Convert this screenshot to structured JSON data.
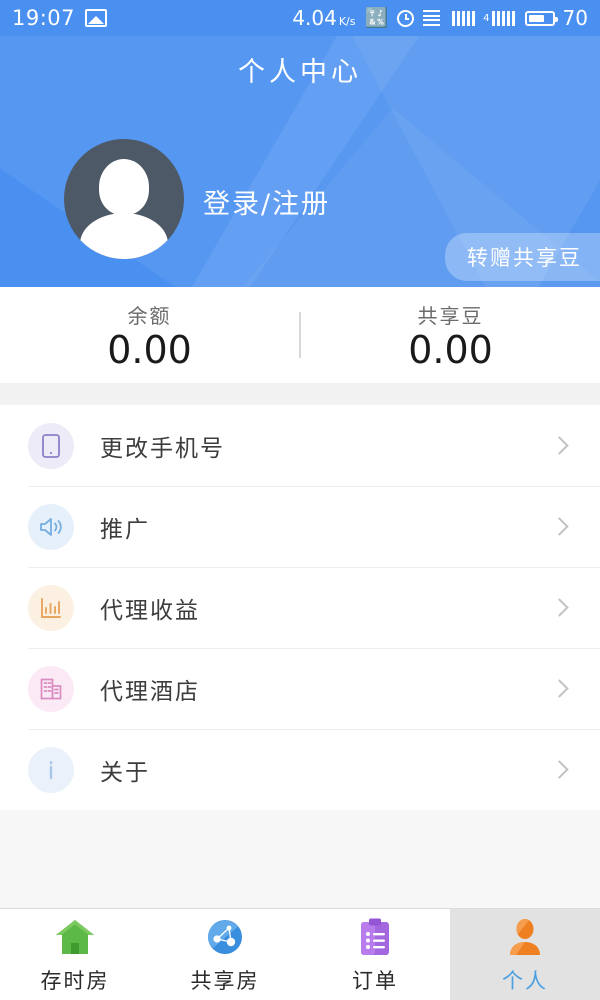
{
  "status_bar": {
    "time": "19:07",
    "screenshot_icon": "image-icon",
    "network_speed": "4.04",
    "network_speed_unit": "K/s",
    "bluetooth_icon": "bluetooth-icon",
    "alarm_icon": "alarm-clock-icon",
    "menu_icon": "list-lines-icon",
    "signal_icon": "signal-bars-icon",
    "network_type": "4",
    "battery_icon": "battery-icon",
    "battery_percent": "70"
  },
  "header": {
    "title": "个人中心",
    "avatar_icon": "user-avatar-placeholder",
    "login_label": "登录/注册",
    "transfer_button": "转赠共享豆",
    "bg_color": "#4a90f0"
  },
  "balance": {
    "items": [
      {
        "label": "余额",
        "value": "0.00"
      },
      {
        "label": "共享豆",
        "value": "0.00"
      }
    ]
  },
  "menu": {
    "items": [
      {
        "label": "更改手机号",
        "icon": "phone-icon",
        "icon_color": "#8b80c8",
        "icon_bg": "#eeebf8"
      },
      {
        "label": "推广",
        "icon": "speaker-icon",
        "icon_color": "#76aee0",
        "icon_bg": "#e6f0fa"
      },
      {
        "label": "代理收益",
        "icon": "bar-chart-icon",
        "icon_color": "#e8a55e",
        "icon_bg": "#fbf0e2"
      },
      {
        "label": "代理酒店",
        "icon": "building-icon",
        "icon_color": "#d98ac0",
        "icon_bg": "#fbeaf5"
      },
      {
        "label": "关于",
        "icon": "info-icon",
        "icon_color": "#a8c7ea",
        "icon_bg": "#eaf1fa"
      }
    ]
  },
  "tabbar": {
    "tabs": [
      {
        "label": "存时房",
        "icon": "home-icon",
        "icon_color": "#5cb947",
        "active": false
      },
      {
        "label": "共享房",
        "icon": "globe-icon",
        "icon_color": "#3a8ede",
        "active": false
      },
      {
        "label": "订单",
        "icon": "clipboard-icon",
        "icon_color": "#a濃",
        "active": false
      },
      {
        "label": "个人",
        "icon": "person-icon",
        "icon_color": "#ee8022",
        "active": true
      }
    ],
    "active_bg": "#e2e2e2",
    "active_label_color": "#4a9fe0"
  }
}
